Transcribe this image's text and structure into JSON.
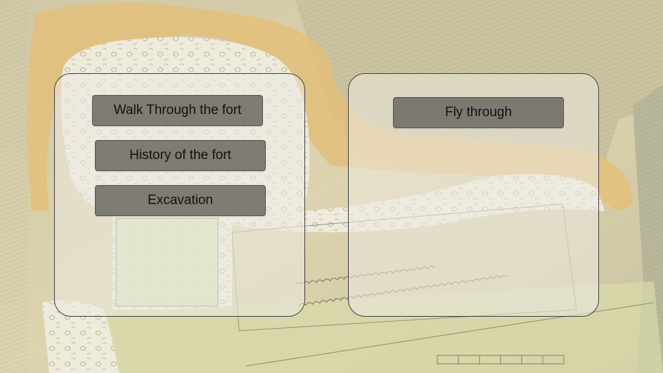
{
  "menu": {
    "walk_through_label": "Walk Through the fort",
    "history_label": "History of the fort",
    "excavation_label": "Excavation",
    "fly_through_label": "Fly through"
  },
  "colors": {
    "parchment": "#d9cfa8",
    "panel_fill": "#eceae2",
    "button_fill": "#6e6c64",
    "button_text": "#111111"
  }
}
